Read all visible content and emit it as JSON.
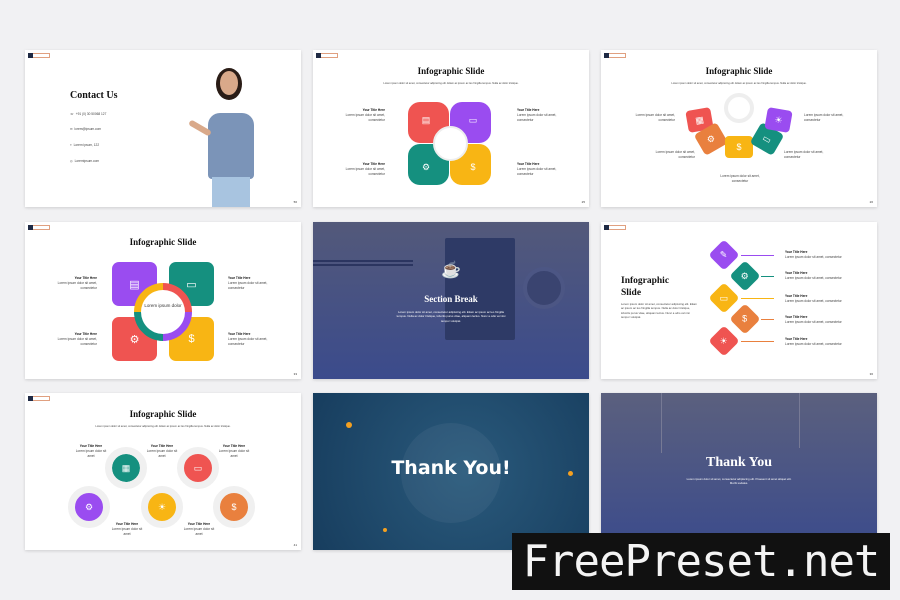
{
  "colors": {
    "red": "#ef5451",
    "purple": "#9a4cf0",
    "teal": "#15907f",
    "yellow": "#f8b514",
    "orange": "#e9803e",
    "navy": "#3b4b85",
    "thankyou_bg": "#1d4a6c"
  },
  "contact": {
    "title": "Contact Us",
    "phone": "+91 (0) 30 50068 127",
    "email": "lorem@ipsum.com",
    "address": "Lorem ipsum, 122",
    "web": "Loremipsum.com",
    "page": "56"
  },
  "slide2": {
    "title": "Infographic Slide",
    "subtitle": "Lorem ipsum dolor sit amet, consectetur adipiscing elit. Etiam ac ipsum ac leo fringilla tempus. Nulla ac dolor tristique.",
    "item_title": "Your Title Here",
    "item_text": "Lorem ipsum dolor sit amet, consectetur",
    "page": "25"
  },
  "slide3": {
    "title": "Infographic Slide",
    "subtitle": "Lorem ipsum dolor sit amet, consectetur adipiscing elit. Etiam ac ipsum ac leo fringilla tempus. Nulla ac dolor tristique.",
    "item_text": "Lorem ipsum dolor sit amet, consectetur",
    "page": "26"
  },
  "slide4": {
    "title": "Infographic Slide",
    "center": "Lorem ipsum dolor",
    "item_title": "Your Title Here",
    "item_text": "Lorem ipsum dolor sit amet, consectetur",
    "page": "33"
  },
  "section": {
    "title": "Section Break",
    "text": "Lorem ipsum dolor sit amet, consectetur adipiscing elit. Etiam ac ipsum ac leo fringilla tempus. Nulla ac dolor tristique, lobortis purus vitae, aliquam lectus. Nunc a odio vel nisi tempor volutpat."
  },
  "slide6": {
    "title": "Infographic Slide",
    "text": "Lorem ipsum dolor sit amet, consectetur adipiscing elit. Etiam ac ipsum ac leo fringilla tempus. Nulla ac dolor tristique, lobortis purus vitae, aliquam lectus. Nunc a odio vel nisi tempor volutpat.",
    "item_title": "Your Title Here",
    "item_text": "Lorem ipsum dolor sit amet, consectetur",
    "page": "36"
  },
  "slide7": {
    "title": "Infographic Slide",
    "subtitle": "Lorem ipsum dolor sit amet, consectetur adipiscing elit. Etiam ac ipsum ac leo fringilla tempus. Nulla ac dolor tristique.",
    "item_title": "Your Title Here",
    "item_text": "Lorem ipsum dolor sit amet",
    "page": "41"
  },
  "thanks1": {
    "title": "Thank You!"
  },
  "thanks2": {
    "title": "Thank You",
    "text": "Lorem ipsum dolor sit amet, consectetur adipiscing elit. Praesent sit amet aliquet elit. Morbi sodales."
  },
  "watermark": "FreePreset.net"
}
